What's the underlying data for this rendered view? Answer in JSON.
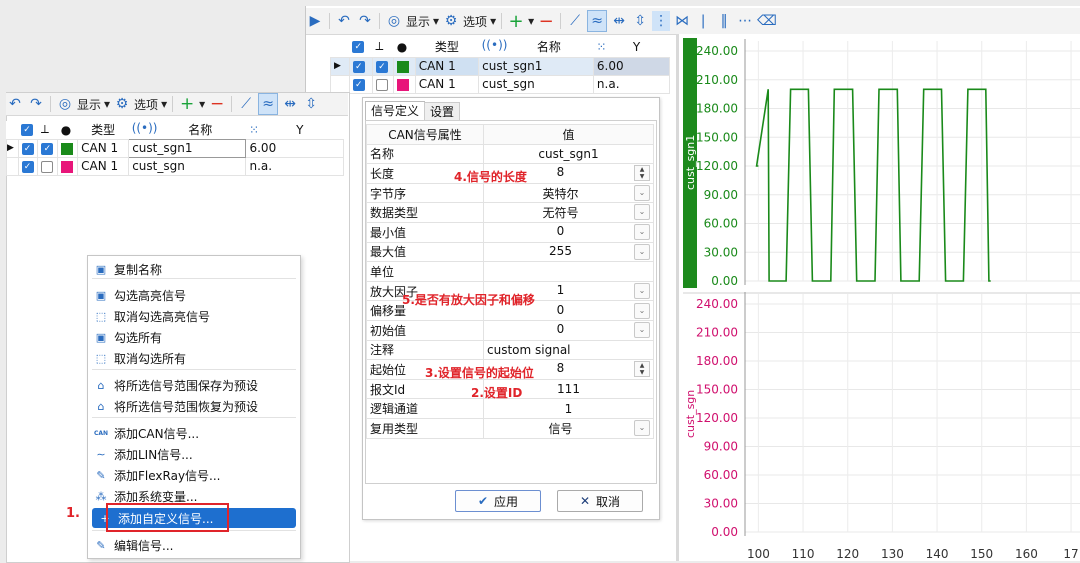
{
  "main_toolbar": {
    "display_label": "显示",
    "options_label": "选项"
  },
  "left_toolbar": {
    "display_label": "显示",
    "options_label": "选项"
  },
  "grid": {
    "headers": {
      "type": "类型",
      "name": "名称",
      "y": "Y"
    },
    "rows": [
      {
        "type": "CAN 1",
        "name": "cust_sgn1",
        "y": "6.00",
        "color": "#1a8a1a"
      },
      {
        "type": "CAN 1",
        "name": "cust_sgn",
        "y": "n.a.",
        "color": "#e8157a"
      }
    ]
  },
  "dialog": {
    "tabs": [
      "信号定义",
      "设置"
    ],
    "col_prop": "CAN信号属性",
    "col_value": "值",
    "rows": [
      {
        "label": "名称",
        "value": "cust_sgn1",
        "ctrl": ""
      },
      {
        "label": "长度",
        "value": "8",
        "ctrl": "spin"
      },
      {
        "label": "字节序",
        "value": "英特尔",
        "ctrl": "dd"
      },
      {
        "label": "数据类型",
        "value": "无符号",
        "ctrl": "dd"
      },
      {
        "label": "最小值",
        "value": "0",
        "ctrl": "dd"
      },
      {
        "label": "最大值",
        "value": "255",
        "ctrl": "dd"
      },
      {
        "label": "单位",
        "value": "",
        "ctrl": ""
      },
      {
        "label": "放大因子",
        "value": "1",
        "ctrl": "dd"
      },
      {
        "label": "偏移量",
        "value": "0",
        "ctrl": "dd"
      },
      {
        "label": "初始值",
        "value": "0",
        "ctrl": "dd"
      },
      {
        "label": "注释",
        "value": "custom signal",
        "ctrl": "",
        "align": "left"
      },
      {
        "label": "起始位",
        "value": "8",
        "ctrl": "spin"
      },
      {
        "label": "报文Id",
        "value": "111",
        "ctrl": ""
      },
      {
        "label": "逻辑通道",
        "value": "1",
        "ctrl": ""
      },
      {
        "label": "复用类型",
        "value": "信号",
        "ctrl": "dd"
      }
    ],
    "ok_label": "应用",
    "cancel_label": "取消"
  },
  "annotations": {
    "length": "4.信号的长度",
    "factor": "5.是否有放大因子和偏移",
    "startbit": "3.设置信号的起始位",
    "msgid": "2.设置ID",
    "step1": "1."
  },
  "context_menu": {
    "items": [
      {
        "label": "复制名称",
        "icon": "copy-icon"
      },
      {
        "label": "勾选高亮信号",
        "icon": "check-highlight-icon"
      },
      {
        "label": "取消勾选高亮信号",
        "icon": "uncheck-highlight-icon"
      },
      {
        "label": "勾选所有",
        "icon": "check-all-icon"
      },
      {
        "label": "取消勾选所有",
        "icon": "uncheck-all-icon"
      },
      {
        "label": "将所选信号范围保存为预设",
        "icon": "home-save-icon"
      },
      {
        "label": "将所选信号范围恢复为预设",
        "icon": "home-restore-icon"
      },
      {
        "label": "添加CAN信号...",
        "icon": "can-icon"
      },
      {
        "label": "添加LIN信号...",
        "icon": "lin-icon"
      },
      {
        "label": "添加FlexRay信号...",
        "icon": "flexray-icon"
      },
      {
        "label": "添加系统变量...",
        "icon": "sysvar-icon"
      },
      {
        "label": "添加自定义信号...",
        "icon": "plus-icon"
      },
      {
        "label": "编辑信号...",
        "icon": "pencil-icon"
      }
    ]
  },
  "charts": {
    "colors": {
      "green": "#1a8a1a",
      "pink": "#d0106e"
    },
    "chart_data": [
      {
        "type": "line",
        "series": [
          {
            "name": "cust_sgn1",
            "x": [
              100,
              99.6,
              102.2,
              102.4,
              106.2,
              107.2,
              111.2,
              112.1,
              116.2,
              117.0,
              121.1,
              122.0,
              126.1,
              127.0,
              131.1,
              131.9,
              136.0,
              137.0,
              141.0,
              141.9,
              145.9,
              146.9,
              150.9,
              151.6,
              152.0
            ],
            "y": [
              120,
              120,
              200,
              0,
              0,
              200,
              200,
              0,
              0,
              200,
              200,
              0,
              0,
              200,
              200,
              0,
              0,
              200,
              200,
              0,
              0,
              200,
              200,
              0,
              0
            ]
          }
        ],
        "ylabel": "cust_sgn1",
        "yticks": [
          "240.00",
          "210.00",
          "180.00",
          "150.00",
          "120.00",
          "90.00",
          "60.00",
          "30.00",
          "0.00"
        ],
        "ylim": [
          0,
          240
        ],
        "xlim": [
          97,
          172
        ]
      },
      {
        "type": "line",
        "series": [
          {
            "name": "cust_sgn",
            "x": [],
            "y": []
          }
        ],
        "ylabel": "cust_sgn",
        "yticks": [
          "240.00",
          "210.00",
          "180.00",
          "150.00",
          "120.00",
          "90.00",
          "60.00",
          "30.00",
          "0.00"
        ],
        "ylim": [
          0,
          240
        ],
        "xticks": [
          "100",
          "110",
          "120",
          "130",
          "140",
          "150",
          "160",
          "17"
        ],
        "xlim": [
          97,
          172
        ]
      }
    ]
  }
}
